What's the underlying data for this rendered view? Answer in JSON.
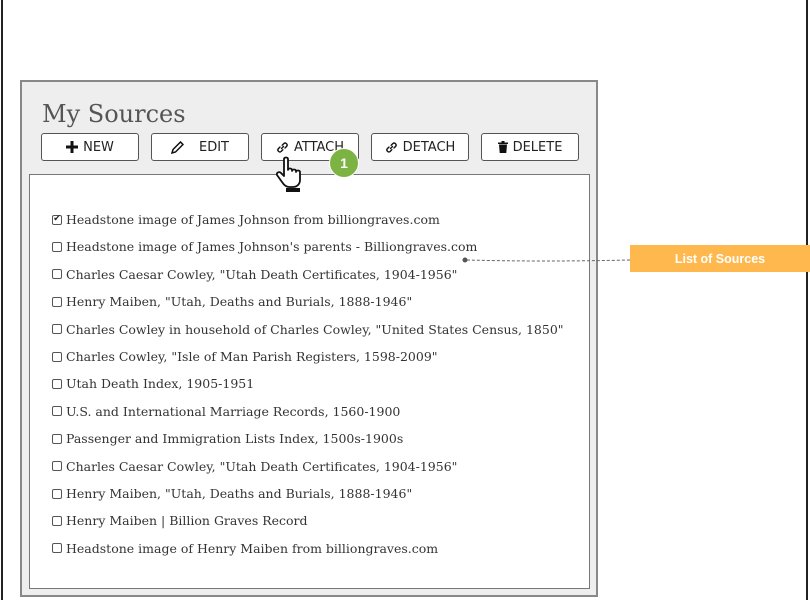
{
  "panel": {
    "title": "My Sources"
  },
  "toolbar": {
    "new_label": "NEW",
    "edit_label": "EDIT",
    "attach_label": "ATTACH",
    "detach_label": "DETACH",
    "delete_label": "DELETE"
  },
  "sources": [
    {
      "label": "Headstone image of James Johnson from billiongraves.com",
      "checked": true
    },
    {
      "label": "Headstone image of James Johnson's parents - Billiongraves.com",
      "checked": false
    },
    {
      "label": "Charles Caesar Cowley, \"Utah Death Certificates, 1904-1956\"",
      "checked": false
    },
    {
      "label": "Henry Maiben, \"Utah, Deaths and Burials, 1888-1946\"",
      "checked": false
    },
    {
      "label": "Charles Cowley in household of Charles Cowley, \"United States Census, 1850\"",
      "checked": false
    },
    {
      "label": "Charles Cowley, \"Isle of Man Parish Registers, 1598-2009\"",
      "checked": false
    },
    {
      "label": "Utah Death Index, 1905-1951",
      "checked": false
    },
    {
      "label": "U.S. and International Marriage Records, 1560-1900",
      "checked": false
    },
    {
      "label": "Passenger and Immigration Lists Index, 1500s-1900s",
      "checked": false
    },
    {
      "label": "Charles Caesar Cowley, \"Utah Death Certificates, 1904-1956\"",
      "checked": false
    },
    {
      "label": "Henry Maiben, \"Utah, Deaths and Burials, 1888-1946\"",
      "checked": false
    },
    {
      "label": "Henry Maiben | Billion Graves Record",
      "checked": false
    },
    {
      "label": "Headstone image of Henry Maiben from billiongraves.com",
      "checked": false
    }
  ],
  "annotation": {
    "step_number": "1",
    "callout_label": "List of Sources",
    "callout_color": "#ffb84d",
    "badge_color": "#7cb342"
  }
}
